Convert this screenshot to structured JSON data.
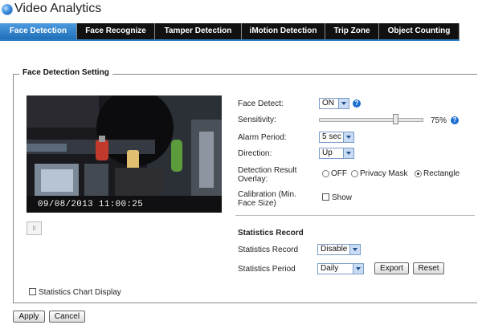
{
  "app": {
    "title": "Video Analytics"
  },
  "tabs": [
    {
      "label": "Face Detection",
      "active": true
    },
    {
      "label": "Face Recognize"
    },
    {
      "label": "Tamper Detection"
    },
    {
      "label": "iMotion Detection"
    },
    {
      "label": "Trip Zone"
    },
    {
      "label": "Object Counting"
    }
  ],
  "section": {
    "title": "Face Detection Setting"
  },
  "video": {
    "timestamp": "09/08/2013  11:00:25"
  },
  "player": {
    "pause_glyph": "II"
  },
  "settings": {
    "face_detect": {
      "label": "Face Detect:",
      "value": "ON"
    },
    "sensitivity": {
      "label": "Sensitivity:",
      "value_text": "75%",
      "value": 0.75
    },
    "alarm_period": {
      "label": "Alarm Period:",
      "value": "5 sec"
    },
    "direction": {
      "label": "Direction:",
      "value": "Up"
    },
    "overlay": {
      "label_line1": "Detection Result",
      "label_line2": "Overlay:",
      "options": [
        "OFF",
        "Privacy Mask",
        "Rectangle"
      ],
      "selected": "Rectangle"
    },
    "calibration": {
      "label_line1": "Calibration (Min.",
      "label_line2": "Face Size)",
      "checkbox_label": "Show"
    }
  },
  "statistics": {
    "title": "Statistics Record",
    "record": {
      "label": "Statistics Record",
      "value": "Disable"
    },
    "period": {
      "label": "Statistics Period",
      "value": "Daily"
    },
    "export_label": "Export",
    "reset_label": "Reset",
    "chart_display_label": "Statistics Chart Display"
  },
  "footer": {
    "apply_label": "Apply",
    "cancel_label": "Cancel"
  },
  "colors": {
    "tab_active": "#2d7fc6",
    "tabbar": "#111111",
    "help_icon": "#1c6fd1"
  }
}
